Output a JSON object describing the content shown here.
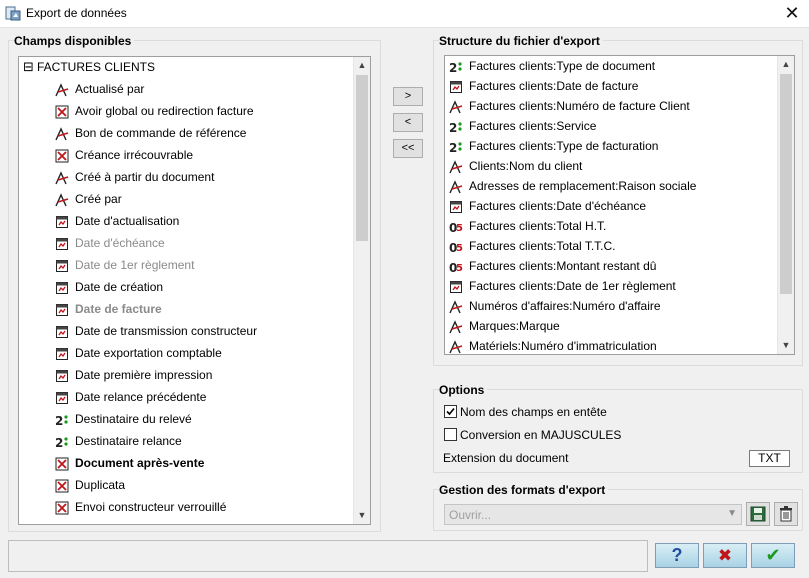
{
  "window": {
    "title": "Export de données",
    "close_glyph": "✕",
    "app_icon": "app-icon"
  },
  "left_panel": {
    "title": "Champs disponibles",
    "root": {
      "expander": "⊟",
      "label": "FACTURES CLIENTS"
    },
    "items": [
      {
        "label": "Actualisé par",
        "icon": "text-field-icon",
        "style": "normal"
      },
      {
        "label": "Avoir global ou redirection facture",
        "icon": "boolean-field-icon",
        "style": "normal"
      },
      {
        "label": "Bon de commande de référence",
        "icon": "text-field-icon",
        "style": "normal"
      },
      {
        "label": "Créance irrécouvrable",
        "icon": "boolean-field-icon",
        "style": "normal"
      },
      {
        "label": "Créé à partir du document",
        "icon": "text-field-icon",
        "style": "normal"
      },
      {
        "label": "Créé par",
        "icon": "text-field-icon",
        "style": "normal"
      },
      {
        "label": "Date d'actualisation",
        "icon": "date-field-icon",
        "style": "normal"
      },
      {
        "label": "Date d'échéance",
        "icon": "date-field-icon",
        "style": "dim"
      },
      {
        "label": "Date de 1er règlement",
        "icon": "date-field-icon",
        "style": "dim"
      },
      {
        "label": "Date de création",
        "icon": "date-field-icon",
        "style": "normal"
      },
      {
        "label": "Date de facture",
        "icon": "date-field-icon",
        "style": "dimbold"
      },
      {
        "label": "Date de transmission constructeur",
        "icon": "date-field-icon",
        "style": "normal"
      },
      {
        "label": "Date exportation comptable",
        "icon": "date-field-icon",
        "style": "normal"
      },
      {
        "label": "Date première impression",
        "icon": "date-field-icon",
        "style": "normal"
      },
      {
        "label": "Date relance précédente",
        "icon": "date-field-icon",
        "style": "normal"
      },
      {
        "label": "Destinataire du relevé",
        "icon": "integer-field-icon",
        "style": "normal"
      },
      {
        "label": "Destinataire relance",
        "icon": "integer-field-icon",
        "style": "normal"
      },
      {
        "label": "Document après-vente",
        "icon": "boolean-field-icon",
        "style": "bold"
      },
      {
        "label": "Duplicata",
        "icon": "boolean-field-icon",
        "style": "normal"
      },
      {
        "label": "Envoi constructeur verrouillé",
        "icon": "boolean-field-icon",
        "style": "normal"
      }
    ]
  },
  "transfer_buttons": {
    "add": ">",
    "remove": "<",
    "remove_all": "<<"
  },
  "right_panel": {
    "title": "Structure du fichier d'export",
    "items": [
      {
        "label": "Factures clients:Type de document",
        "icon": "integer-field-icon"
      },
      {
        "label": "Factures clients:Date de facture",
        "icon": "date-field-icon"
      },
      {
        "label": "Factures clients:Numéro de facture Client",
        "icon": "text-field-icon"
      },
      {
        "label": "Factures clients:Service",
        "icon": "integer-field-icon"
      },
      {
        "label": "Factures clients:Type de facturation",
        "icon": "integer-field-icon"
      },
      {
        "label": "Clients:Nom du client",
        "icon": "text-field-icon"
      },
      {
        "label": "Adresses de remplacement:Raison sociale",
        "icon": "text-field-icon"
      },
      {
        "label": "Factures clients:Date d'échéance",
        "icon": "date-field-icon"
      },
      {
        "label": "Factures clients:Total H.T.",
        "icon": "decimal-field-icon"
      },
      {
        "label": "Factures clients:Total T.T.C.",
        "icon": "decimal-field-icon"
      },
      {
        "label": "Factures clients:Montant restant dû",
        "icon": "decimal-field-icon"
      },
      {
        "label": "Factures clients:Date de 1er règlement",
        "icon": "date-field-icon"
      },
      {
        "label": "Numéros d'affaires:Numéro d'affaire",
        "icon": "text-field-icon"
      },
      {
        "label": "Marques:Marque",
        "icon": "text-field-icon"
      },
      {
        "label": "Matériels:Numéro d'immatriculation",
        "icon": "text-field-icon"
      }
    ]
  },
  "options": {
    "title": "Options",
    "header_checkbox": {
      "label": "Nom des champs en entête",
      "checked": true
    },
    "uppercase_checkbox": {
      "label": "Conversion en MAJUSCULES",
      "checked": false
    },
    "extension_label": "Extension du document",
    "extension_value": "TXT"
  },
  "formats": {
    "title": "Gestion des formats d'export",
    "combo_placeholder": "Ouvrir...",
    "save_icon": "save-icon",
    "delete_icon": "trash-icon"
  },
  "footer": {
    "help_glyph": "?",
    "cancel_glyph": "✖",
    "ok_glyph": "✔",
    "colors": {
      "help": "#1f4e9c",
      "cancel": "#c0151a",
      "ok": "#1a9a1a"
    }
  }
}
